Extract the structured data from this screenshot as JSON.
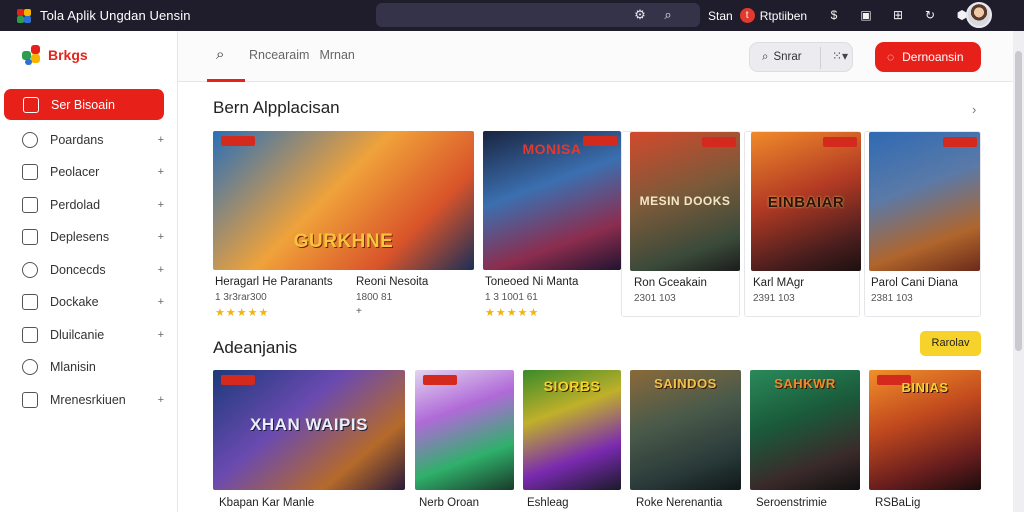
{
  "titlebar": {
    "title": "Tola Aplik Ungdan Uensin",
    "user_label": "Stan",
    "user_badge": "t",
    "user_name": "Rtptiiben"
  },
  "sidebar": {
    "brand": "Brkgs",
    "items": [
      {
        "label": "Ser Bisoain",
        "active": true
      },
      {
        "label": "Poardans",
        "arrow": "+"
      },
      {
        "label": "Peolacer",
        "arrow": "+"
      },
      {
        "label": "Perdolad",
        "arrow": "+"
      },
      {
        "label": "Deplesens",
        "arrow": "+"
      },
      {
        "label": "Doncecds",
        "arrow": "+"
      },
      {
        "label": "Dockake",
        "arrow": "+"
      },
      {
        "label": "Dluilcanie",
        "arrow": "+"
      },
      {
        "label": "Mlanisin"
      },
      {
        "label": "Mrenesrkiuen",
        "arrow": "+"
      }
    ]
  },
  "topbar": {
    "search_label": "Rncearaim",
    "search_extra": "Mrnan",
    "pill_search": "Snrar",
    "cta_label": "Dernoansin"
  },
  "sections": {
    "first_title": "Bern Alpplacisan",
    "second_title": "Adeanjanis",
    "second_button": "Rarolav"
  },
  "cards_row1": [
    {
      "title": "GURKHNE",
      "name": "Heragarl He Paranants",
      "meta": "1 3r3rar300",
      "rating": "★★★★★"
    },
    {
      "title": "",
      "name": "Reoni Nesoita",
      "meta": "1800 81",
      "rating": "+"
    },
    {
      "title": "MONISA",
      "name": "Toneoed Ni Manta",
      "meta": "1 3 1001 61",
      "rating": "★★★★★"
    },
    {
      "title": "MESIN DOOKS",
      "name": "Ron Gceakain",
      "meta": "2301 103",
      "rating": ""
    },
    {
      "title": "EINBAIAR",
      "name": "Karl MAgr",
      "meta": "2391 103",
      "rating": ""
    },
    {
      "title": "",
      "name": "Parol Cani Diana",
      "meta": "2381 103",
      "rating": ""
    }
  ],
  "cards_row2": [
    {
      "title": "XHAN WAIPIS",
      "name": "Kbapan Kar Manle"
    },
    {
      "title": "",
      "name": "Nerb Oroan"
    },
    {
      "title": "SIORBS",
      "name": "Eshleag"
    },
    {
      "title": "SAINDOS",
      "name": "Roke Nerenantia"
    },
    {
      "title": "SAHKWR",
      "name": "Seroenstrimie"
    },
    {
      "title": "BINIAS",
      "name": "RSBaLig"
    }
  ],
  "colors": {
    "accent": "#e8201a",
    "titlebar": "#1f1d2b",
    "highlight": "#f7d22a",
    "star": "#f2b410"
  }
}
